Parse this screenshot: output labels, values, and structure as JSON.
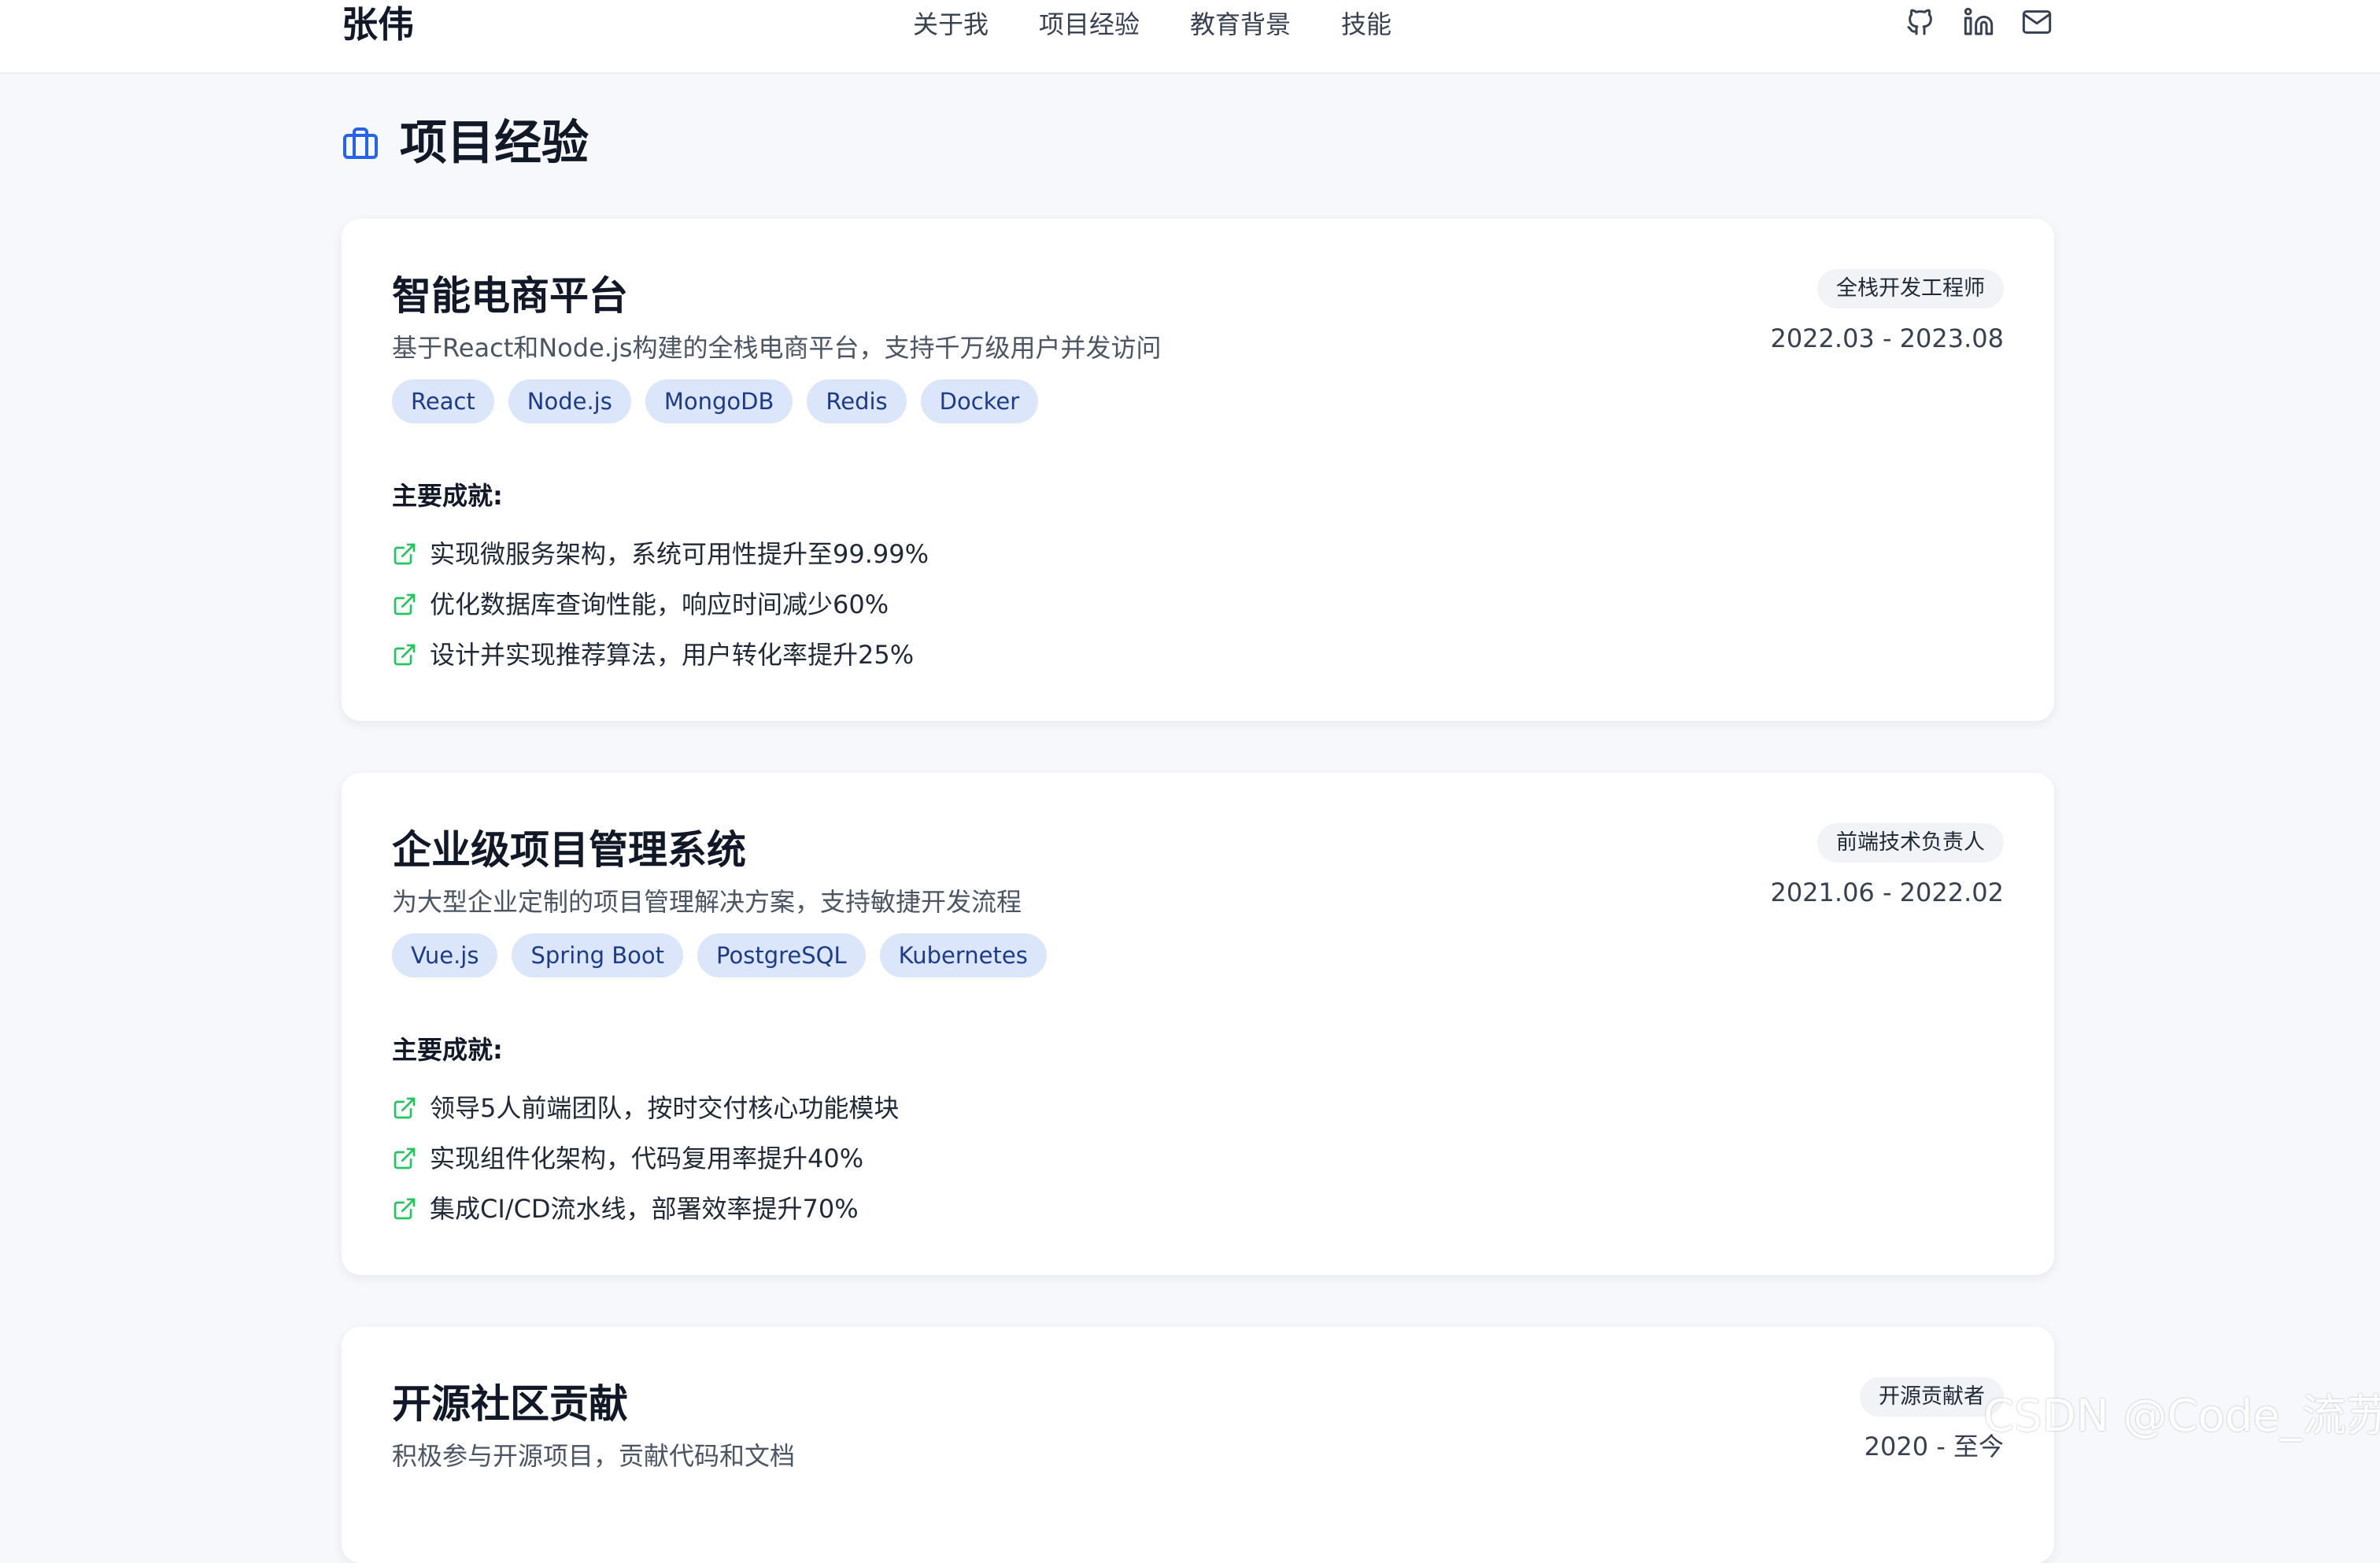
{
  "header": {
    "logo": "张伟",
    "nav": [
      "关于我",
      "项目经验",
      "教育背景",
      "技能"
    ],
    "social_icons": [
      "github-icon",
      "linkedin-icon",
      "mail-icon"
    ]
  },
  "section": {
    "title": "项目经验",
    "icon": "briefcase-icon"
  },
  "projects": [
    {
      "title": "智能电商平台",
      "description": "基于React和Node.js构建的全栈电商平台，支持千万级用户并发访问",
      "tags": [
        "React",
        "Node.js",
        "MongoDB",
        "Redis",
        "Docker"
      ],
      "role": "全栈开发工程师",
      "period": "2022.03 - 2023.08",
      "achievements_label": "主要成就:",
      "achievements": [
        "实现微服务架构，系统可用性提升至99.99%",
        "优化数据库查询性能，响应时间减少60%",
        "设计并实现推荐算法，用户转化率提升25%"
      ]
    },
    {
      "title": "企业级项目管理系统",
      "description": "为大型企业定制的项目管理解决方案，支持敏捷开发流程",
      "tags": [
        "Vue.js",
        "Spring Boot",
        "PostgreSQL",
        "Kubernetes"
      ],
      "role": "前端技术负责人",
      "period": "2021.06 - 2022.02",
      "achievements_label": "主要成就:",
      "achievements": [
        "领导5人前端团队，按时交付核心功能模块",
        "实现组件化架构，代码复用率提升40%",
        "集成CI/CD流水线，部署效率提升70%"
      ]
    },
    {
      "title": "开源社区贡献",
      "description": "积极参与开源项目，贡献代码和文档",
      "role": "开源贡献者",
      "period": "2020 - 至今"
    }
  ],
  "watermark": "CSDN @Code_流苏",
  "colors": {
    "accent": "#2563eb",
    "tag_bg": "#dbe6fa",
    "tag_text": "#1e3a8a",
    "achievement_icon": "#22c55e",
    "page_bg": "#f6f8fb"
  }
}
